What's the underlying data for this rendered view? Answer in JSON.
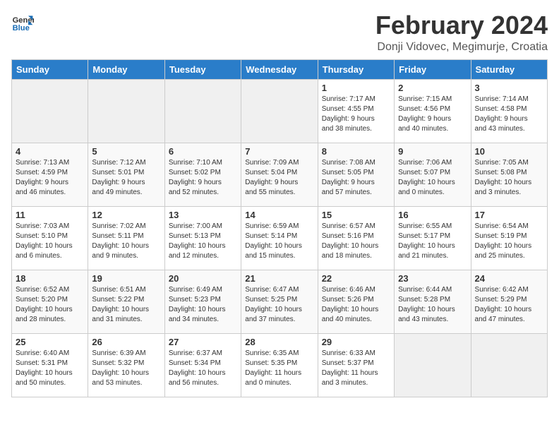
{
  "header": {
    "logo_general": "General",
    "logo_blue": "Blue",
    "title": "February 2024",
    "subtitle": "Donji Vidovec, Megimurje, Croatia"
  },
  "weekdays": [
    "Sunday",
    "Monday",
    "Tuesday",
    "Wednesday",
    "Thursday",
    "Friday",
    "Saturday"
  ],
  "weeks": [
    [
      {
        "day": "",
        "info": ""
      },
      {
        "day": "",
        "info": ""
      },
      {
        "day": "",
        "info": ""
      },
      {
        "day": "",
        "info": ""
      },
      {
        "day": "1",
        "info": "Sunrise: 7:17 AM\nSunset: 4:55 PM\nDaylight: 9 hours\nand 38 minutes."
      },
      {
        "day": "2",
        "info": "Sunrise: 7:15 AM\nSunset: 4:56 PM\nDaylight: 9 hours\nand 40 minutes."
      },
      {
        "day": "3",
        "info": "Sunrise: 7:14 AM\nSunset: 4:58 PM\nDaylight: 9 hours\nand 43 minutes."
      }
    ],
    [
      {
        "day": "4",
        "info": "Sunrise: 7:13 AM\nSunset: 4:59 PM\nDaylight: 9 hours\nand 46 minutes."
      },
      {
        "day": "5",
        "info": "Sunrise: 7:12 AM\nSunset: 5:01 PM\nDaylight: 9 hours\nand 49 minutes."
      },
      {
        "day": "6",
        "info": "Sunrise: 7:10 AM\nSunset: 5:02 PM\nDaylight: 9 hours\nand 52 minutes."
      },
      {
        "day": "7",
        "info": "Sunrise: 7:09 AM\nSunset: 5:04 PM\nDaylight: 9 hours\nand 55 minutes."
      },
      {
        "day": "8",
        "info": "Sunrise: 7:08 AM\nSunset: 5:05 PM\nDaylight: 9 hours\nand 57 minutes."
      },
      {
        "day": "9",
        "info": "Sunrise: 7:06 AM\nSunset: 5:07 PM\nDaylight: 10 hours\nand 0 minutes."
      },
      {
        "day": "10",
        "info": "Sunrise: 7:05 AM\nSunset: 5:08 PM\nDaylight: 10 hours\nand 3 minutes."
      }
    ],
    [
      {
        "day": "11",
        "info": "Sunrise: 7:03 AM\nSunset: 5:10 PM\nDaylight: 10 hours\nand 6 minutes."
      },
      {
        "day": "12",
        "info": "Sunrise: 7:02 AM\nSunset: 5:11 PM\nDaylight: 10 hours\nand 9 minutes."
      },
      {
        "day": "13",
        "info": "Sunrise: 7:00 AM\nSunset: 5:13 PM\nDaylight: 10 hours\nand 12 minutes."
      },
      {
        "day": "14",
        "info": "Sunrise: 6:59 AM\nSunset: 5:14 PM\nDaylight: 10 hours\nand 15 minutes."
      },
      {
        "day": "15",
        "info": "Sunrise: 6:57 AM\nSunset: 5:16 PM\nDaylight: 10 hours\nand 18 minutes."
      },
      {
        "day": "16",
        "info": "Sunrise: 6:55 AM\nSunset: 5:17 PM\nDaylight: 10 hours\nand 21 minutes."
      },
      {
        "day": "17",
        "info": "Sunrise: 6:54 AM\nSunset: 5:19 PM\nDaylight: 10 hours\nand 25 minutes."
      }
    ],
    [
      {
        "day": "18",
        "info": "Sunrise: 6:52 AM\nSunset: 5:20 PM\nDaylight: 10 hours\nand 28 minutes."
      },
      {
        "day": "19",
        "info": "Sunrise: 6:51 AM\nSunset: 5:22 PM\nDaylight: 10 hours\nand 31 minutes."
      },
      {
        "day": "20",
        "info": "Sunrise: 6:49 AM\nSunset: 5:23 PM\nDaylight: 10 hours\nand 34 minutes."
      },
      {
        "day": "21",
        "info": "Sunrise: 6:47 AM\nSunset: 5:25 PM\nDaylight: 10 hours\nand 37 minutes."
      },
      {
        "day": "22",
        "info": "Sunrise: 6:46 AM\nSunset: 5:26 PM\nDaylight: 10 hours\nand 40 minutes."
      },
      {
        "day": "23",
        "info": "Sunrise: 6:44 AM\nSunset: 5:28 PM\nDaylight: 10 hours\nand 43 minutes."
      },
      {
        "day": "24",
        "info": "Sunrise: 6:42 AM\nSunset: 5:29 PM\nDaylight: 10 hours\nand 47 minutes."
      }
    ],
    [
      {
        "day": "25",
        "info": "Sunrise: 6:40 AM\nSunset: 5:31 PM\nDaylight: 10 hours\nand 50 minutes."
      },
      {
        "day": "26",
        "info": "Sunrise: 6:39 AM\nSunset: 5:32 PM\nDaylight: 10 hours\nand 53 minutes."
      },
      {
        "day": "27",
        "info": "Sunrise: 6:37 AM\nSunset: 5:34 PM\nDaylight: 10 hours\nand 56 minutes."
      },
      {
        "day": "28",
        "info": "Sunrise: 6:35 AM\nSunset: 5:35 PM\nDaylight: 11 hours\nand 0 minutes."
      },
      {
        "day": "29",
        "info": "Sunrise: 6:33 AM\nSunset: 5:37 PM\nDaylight: 11 hours\nand 3 minutes."
      },
      {
        "day": "",
        "info": ""
      },
      {
        "day": "",
        "info": ""
      }
    ]
  ]
}
